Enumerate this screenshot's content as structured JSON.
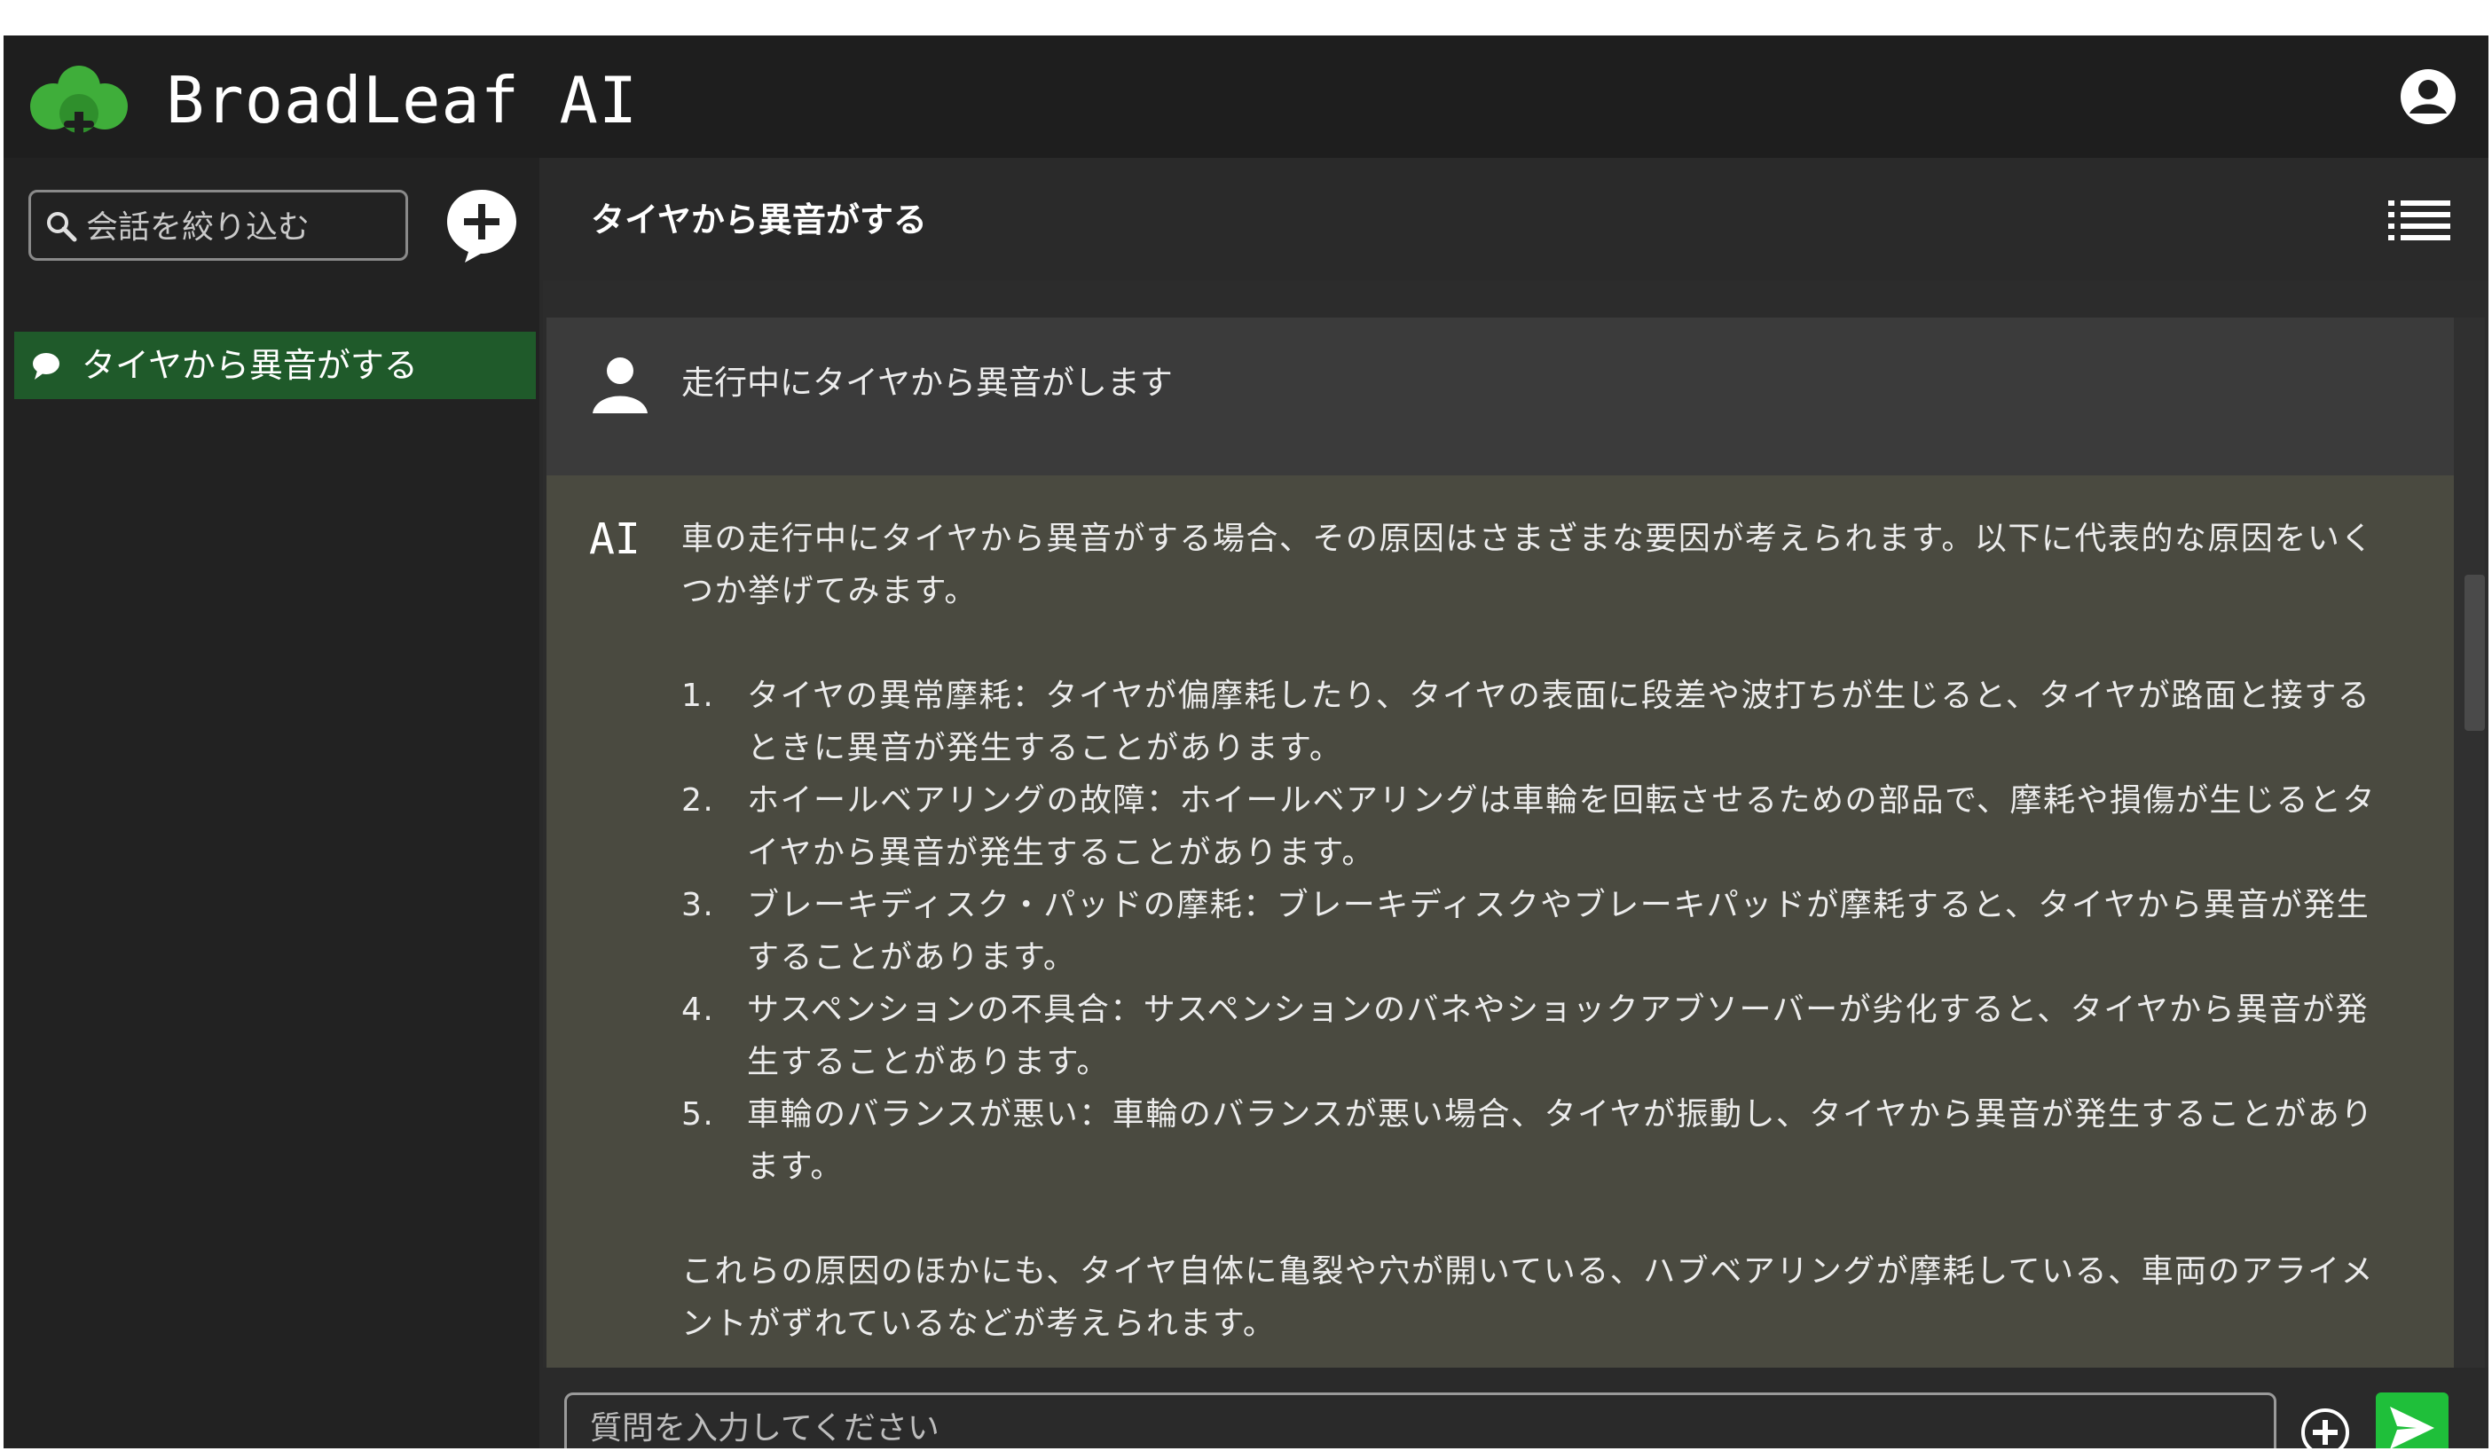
{
  "app": {
    "brand": "BroadLeaf AI"
  },
  "sidebar": {
    "filter_placeholder": "会話を絞り込む",
    "conversations": [
      {
        "label": "タイヤから異音がする",
        "active": true
      }
    ]
  },
  "main": {
    "title": "タイヤから異音がする",
    "user_message": "走行中にタイヤから異音がします",
    "ai_label": "AI",
    "ai_message": {
      "intro": "車の走行中にタイヤから異音がする場合、その原因はさまざまな要因が考えられます。以下に代表的な原因をいくつか挙げてみます。",
      "items": [
        {
          "num": "1.",
          "text": "タイヤの異常摩耗：タイヤが偏摩耗したり、タイヤの表面に段差や波打ちが生じると、タイヤが路面と接するときに異音が発生することがあります。"
        },
        {
          "num": "2.",
          "text": "ホイールベアリングの故障：ホイールベアリングは車輪を回転させるための部品で、摩耗や損傷が生じるとタイヤから異音が発生することがあります。"
        },
        {
          "num": "3.",
          "text": "ブレーキディスク・パッドの摩耗：ブレーキディスクやブレーキパッドが摩耗すると、タイヤから異音が発生することがあります。"
        },
        {
          "num": "4.",
          "text": "サスペンションの不具合：サスペンションのバネやショックアブソーバーが劣化すると、タイヤから異音が発生することがあります。"
        },
        {
          "num": "5.",
          "text": "車輪のバランスが悪い：車輪のバランスが悪い場合、タイヤが振動し、タイヤから異音が発生することがあります。"
        }
      ],
      "outro": "これらの原因のほかにも、タイヤ自体に亀裂や穴が開いている、ハブベアリングが摩耗している、車両のアライメントがずれているなどが考えられます。"
    }
  },
  "composer": {
    "placeholder": "質問を入力してください"
  },
  "colors": {
    "accent_green": "#1fbf3a",
    "active_item": "#1f5a2a",
    "header_bg": "#1e1e1e",
    "ai_message_bg": "#4a4a40",
    "user_message_bg": "#3b3b3b"
  },
  "icons": [
    "leaf-logo-icon",
    "account-icon",
    "search-icon",
    "add-conversation-icon",
    "chat-bubble-icon",
    "menu-list-icon",
    "user-icon",
    "attach-plus-icon",
    "send-icon"
  ]
}
